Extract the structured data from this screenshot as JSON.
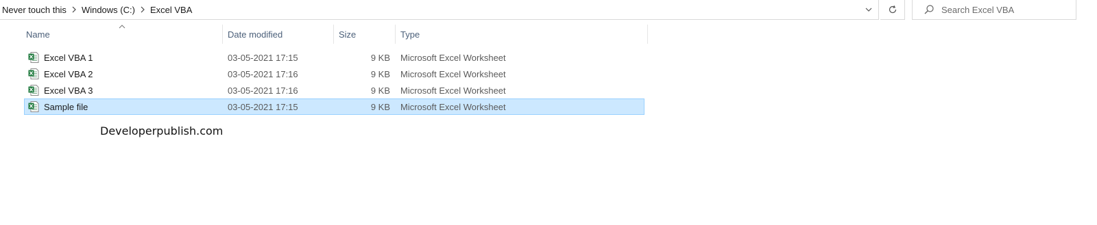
{
  "address_bar": {
    "breadcrumbs": [
      "Never touch this",
      "Windows (C:)",
      "Excel VBA"
    ]
  },
  "search": {
    "placeholder": "Search Excel VBA"
  },
  "columns": [
    "Name",
    "Date modified",
    "Size",
    "Type"
  ],
  "files": [
    {
      "name": "Excel VBA 1",
      "date": "03-05-2021 17:15",
      "size": "9 KB",
      "type": "Microsoft Excel Worksheet",
      "selected": false,
      "icon": "excel-file-icon"
    },
    {
      "name": "Excel VBA 2",
      "date": "03-05-2021 17:16",
      "size": "9 KB",
      "type": "Microsoft Excel Worksheet",
      "selected": false,
      "icon": "excel-file-icon"
    },
    {
      "name": "Excel VBA 3",
      "date": "03-05-2021 17:16",
      "size": "9 KB",
      "type": "Microsoft Excel Worksheet",
      "selected": false,
      "icon": "excel-file-icon"
    },
    {
      "name": "Sample file",
      "date": "03-05-2021 17:15",
      "size": "9 KB",
      "type": "Microsoft Excel Worksheet",
      "selected": true,
      "icon": "excel-file-icon"
    }
  ],
  "watermark": "Developerpublish.com",
  "colors": {
    "selection_bg": "#cce8ff",
    "selection_border": "#99d1ff",
    "header_text": "#4c607a",
    "excel_green": "#1f7a3e"
  }
}
